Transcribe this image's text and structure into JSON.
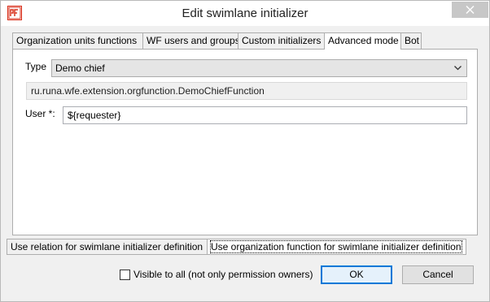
{
  "window": {
    "title": "Edit swimlane initializer",
    "app_icon": "runa-wfe-icon"
  },
  "top_tabs": [
    {
      "label": "Organization units functions"
    },
    {
      "label": "WF users and groups"
    },
    {
      "label": "Custom initializers"
    },
    {
      "label": "Advanced mode"
    },
    {
      "label": "Bot"
    }
  ],
  "active_top_tab": "Advanced mode",
  "form": {
    "type_label": "Type",
    "type_value": "Demo chief",
    "class_value": "ru.runa.wfe.extension.orgfunction.DemoChiefFunction",
    "user_label": "User *:",
    "user_value": "${requester}"
  },
  "bottom_tabs": [
    {
      "label": "Use relation for swimlane initializer definition"
    },
    {
      "label": "Use organization function for swimlane initializer definition"
    }
  ],
  "active_bottom_tab": "Use organization function for swimlane initializer definition",
  "footer": {
    "visible_label": "Visible to all (not only permission owners)",
    "visible_checked": false,
    "ok_label": "OK",
    "cancel_label": "Cancel"
  },
  "colors": {
    "accent": "#0078d7",
    "close_bg": "#c7c7c7",
    "icon_red": "#d9301c"
  }
}
